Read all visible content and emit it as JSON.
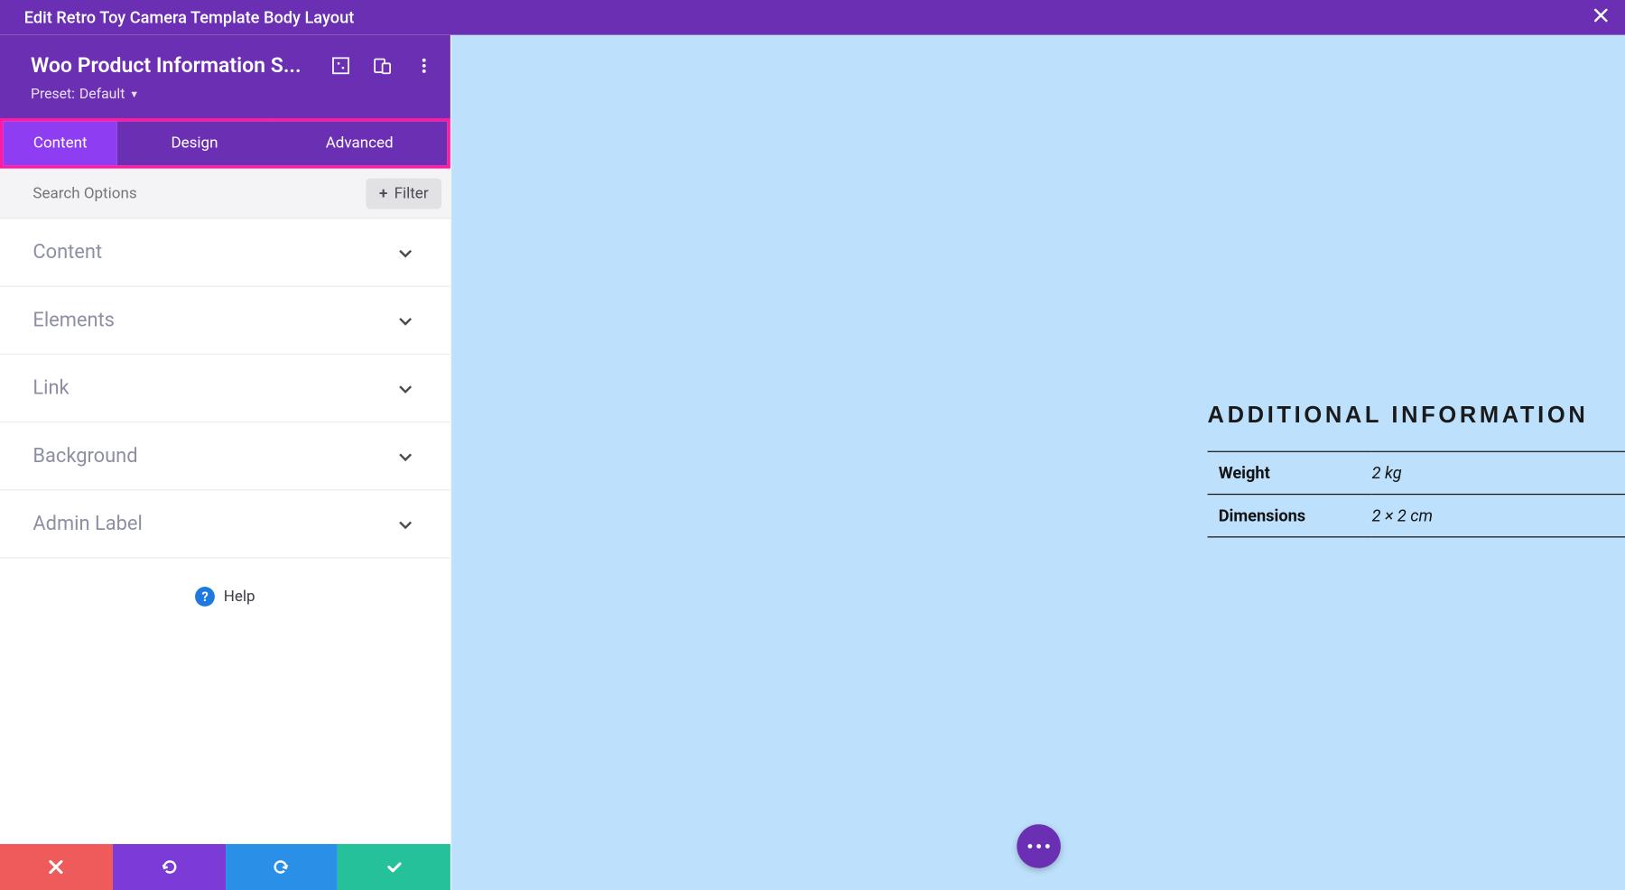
{
  "topbar": {
    "title": "Edit Retro Toy Camera Template Body Layout"
  },
  "module": {
    "title": "Woo Product Information S...",
    "preset_label": "Preset:",
    "preset_value": "Default"
  },
  "tabs": {
    "content": "Content",
    "design": "Design",
    "advanced": "Advanced"
  },
  "search": {
    "placeholder": "Search Options",
    "filter_label": "Filter"
  },
  "accordion": {
    "content": "Content",
    "elements": "Elements",
    "link": "Link",
    "background": "Background",
    "admin_label": "Admin Label"
  },
  "help": {
    "label": "Help"
  },
  "preview": {
    "heading": "ADDITIONAL INFORMATION",
    "rows": {
      "weight_label": "Weight",
      "weight_value": "2 kg",
      "dimensions_label": "Dimensions",
      "dimensions_value": "2 × 2 cm"
    }
  }
}
